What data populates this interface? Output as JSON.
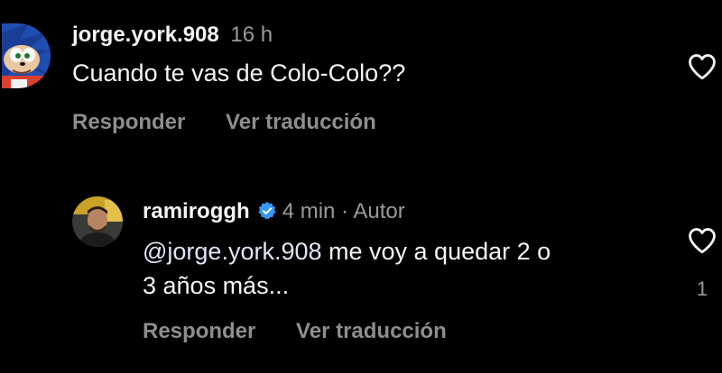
{
  "comments": [
    {
      "username": "jorge.york.908",
      "time": "16 h",
      "text": "Cuando te vas de Colo-Colo??",
      "reply_label": "Responder",
      "translate_label": "Ver traducción",
      "avatar_icon": "sonic-avatar-icon",
      "like_icon": "heart-outline-icon"
    },
    {
      "username": "ramiroggh",
      "verified": true,
      "time": "4 min",
      "separator": "·",
      "author_badge": "Autor",
      "mention": "@jorge.york.908",
      "text_line1": " me voy a quedar 2 o",
      "text_line2": "3 años más...",
      "reply_label": "Responder",
      "translate_label": "Ver traducción",
      "like_count": "1",
      "avatar_icon": "profile-photo-avatar",
      "like_icon": "heart-outline-icon"
    }
  ],
  "colors": {
    "background": "#000000",
    "text": "#f5f5f5",
    "secondary": "#8e8e8e",
    "verified_blue": "#3797f0"
  }
}
